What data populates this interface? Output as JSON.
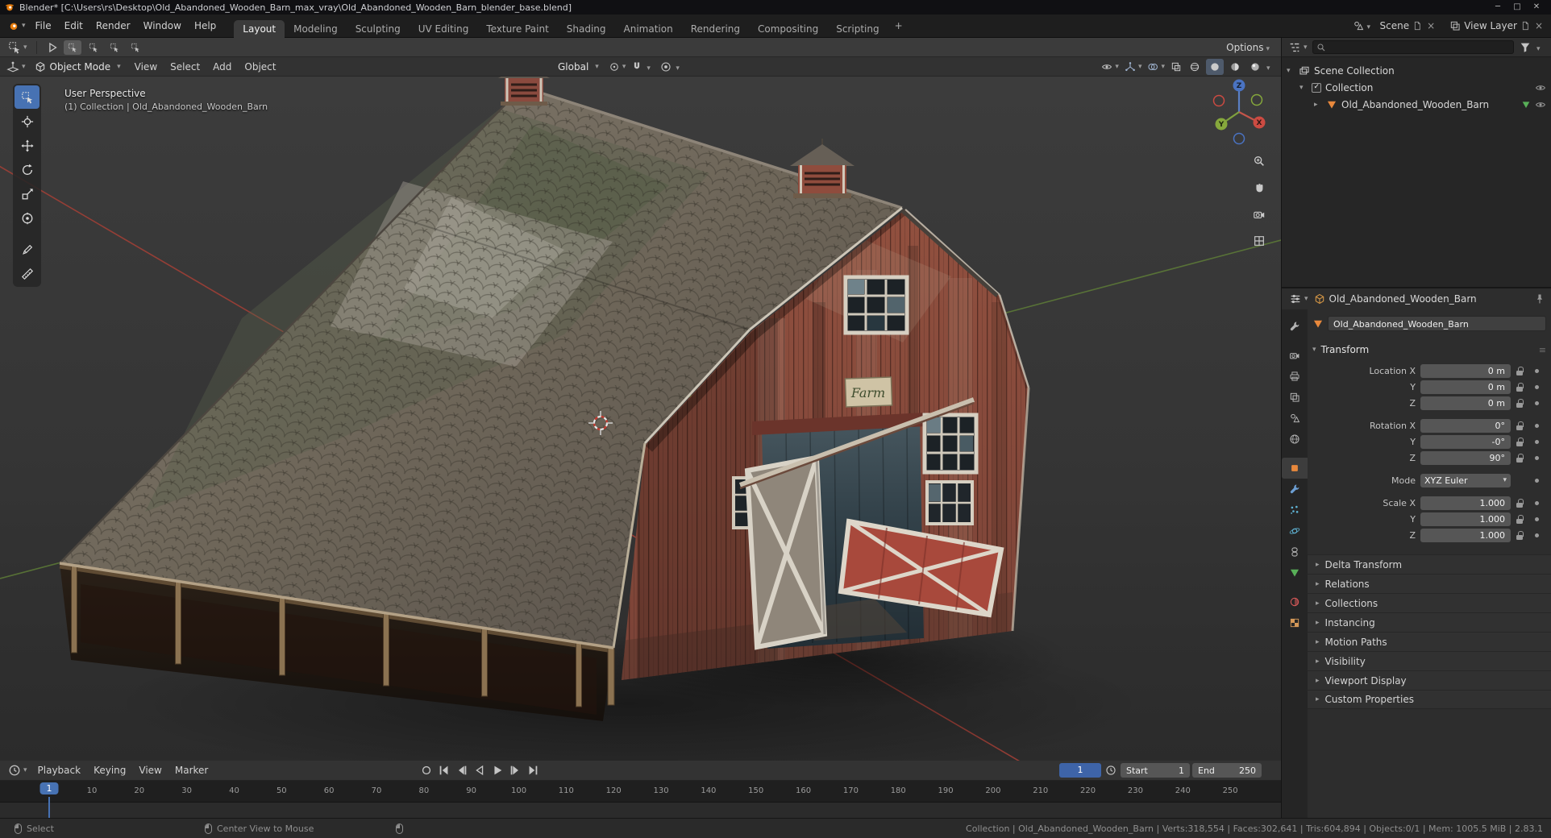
{
  "window": {
    "title": "Blender* [C:\\Users\\rs\\Desktop\\Old_Abandoned_Wooden_Barn_max_vray\\Old_Abandoned_Wooden_Barn_blender_base.blend]"
  },
  "topbar": {
    "menus": [
      "File",
      "Edit",
      "Render",
      "Window",
      "Help"
    ],
    "workspaces": [
      "Layout",
      "Modeling",
      "Sculpting",
      "UV Editing",
      "Texture Paint",
      "Shading",
      "Animation",
      "Rendering",
      "Compositing",
      "Scripting"
    ],
    "active_workspace": "Layout",
    "add_workspace": "+",
    "scene": {
      "label": "Scene"
    },
    "view_layer": {
      "label": "View Layer"
    }
  },
  "toolrow": {
    "options_label": "Options"
  },
  "viewport": {
    "header": {
      "mode": "Object Mode",
      "menus": [
        "View",
        "Select",
        "Add",
        "Object"
      ],
      "orientation": "Global"
    },
    "overlay": {
      "line1": "User Perspective",
      "line2": "(1) Collection | Old_Abandoned_Wooden_Barn"
    },
    "gizmo": {
      "x": "X",
      "y": "Y",
      "z": "Z"
    },
    "tools": [
      {
        "name": "select-box",
        "active": true
      },
      {
        "name": "cursor"
      },
      {
        "name": "move"
      },
      {
        "name": "rotate"
      },
      {
        "name": "scale"
      },
      {
        "name": "transform"
      },
      {
        "name": "annotate"
      },
      {
        "name": "measure"
      }
    ]
  },
  "outliner": {
    "rows": [
      {
        "label": "Scene Collection"
      },
      {
        "label": "Collection"
      },
      {
        "label": "Old_Abandoned_Wooden_Barn"
      }
    ]
  },
  "properties": {
    "breadcrumb": "Old_Abandoned_Wooden_Barn",
    "name_value": "Old_Abandoned_Wooden_Barn",
    "tabs": [
      {
        "name": "tool",
        "icon": "wrench",
        "color": "#b4b4b4"
      },
      {
        "name": "render",
        "icon": "cameraic",
        "color": "#b4b4b4"
      },
      {
        "name": "output",
        "icon": "printer",
        "color": "#b4b4b4"
      },
      {
        "name": "view-layer",
        "icon": "layers",
        "color": "#b4b4b4"
      },
      {
        "name": "scene",
        "icon": "scene",
        "color": "#b4b4b4"
      },
      {
        "name": "world",
        "icon": "globe",
        "color": "#b4b4b4"
      },
      {
        "name": "object",
        "icon": "square",
        "color": "#e8883c",
        "active": true
      },
      {
        "name": "modifiers",
        "icon": "wrench",
        "color": "#6d9fd4"
      },
      {
        "name": "particles",
        "icon": "particles",
        "color": "#5fb3d4"
      },
      {
        "name": "physics",
        "icon": "physics",
        "color": "#5fb3d4"
      },
      {
        "name": "constraints",
        "icon": "constraint",
        "color": "#b4b4b4"
      },
      {
        "name": "object-data",
        "icon": "meshtri",
        "color": "#58b058"
      },
      {
        "name": "material",
        "icon": "matsphere",
        "color": "#d45858"
      },
      {
        "name": "texture",
        "icon": "checker",
        "color": "#d49858"
      }
    ],
    "transform": {
      "title": "Transform",
      "location": [
        {
          "label": "Location X",
          "value": "0 m"
        },
        {
          "label": "Y",
          "value": "0 m"
        },
        {
          "label": "Z",
          "value": "0 m"
        }
      ],
      "rotation": [
        {
          "label": "Rotation X",
          "value": "0°"
        },
        {
          "label": "Y",
          "value": "-0°"
        },
        {
          "label": "Z",
          "value": "90°"
        }
      ],
      "mode": {
        "label": "Mode",
        "value": "XYZ Euler"
      },
      "scale": [
        {
          "label": "Scale X",
          "value": "1.000"
        },
        {
          "label": "Y",
          "value": "1.000"
        },
        {
          "label": "Z",
          "value": "1.000"
        }
      ]
    },
    "sections": [
      "Delta Transform",
      "Relations",
      "Collections",
      "Instancing",
      "Motion Paths",
      "Visibility",
      "Viewport Display",
      "Custom Properties"
    ]
  },
  "timeline": {
    "menus": [
      "Playback",
      "Keying",
      "View",
      "Marker"
    ],
    "current_frame": "1",
    "start_label": "Start",
    "start_value": "1",
    "end_label": "End",
    "end_value": "250",
    "ticks": [
      "1",
      "10",
      "20",
      "30",
      "40",
      "50",
      "60",
      "70",
      "80",
      "90",
      "100",
      "110",
      "120",
      "130",
      "140",
      "150",
      "160",
      "170",
      "180",
      "190",
      "200",
      "210",
      "220",
      "230",
      "240",
      "250"
    ]
  },
  "statusbar": {
    "select_label": "Select",
    "center_label": "Center View to Mouse",
    "stats": "Collection | Old_Abandoned_Wooden_Barn | Verts:318,554 | Faces:302,641 | Tris:604,894 | Objects:0/1 | Mem: 1005.5 MiB | 2.83.1"
  },
  "barn": {
    "sign_text": "Farm"
  },
  "colors": {
    "accent_blue": "#4772b3",
    "barn_red": "#8d4e41",
    "roof_gray": "#6e6659",
    "axis_x": "#a03f36",
    "axis_y": "#5e7c37"
  }
}
